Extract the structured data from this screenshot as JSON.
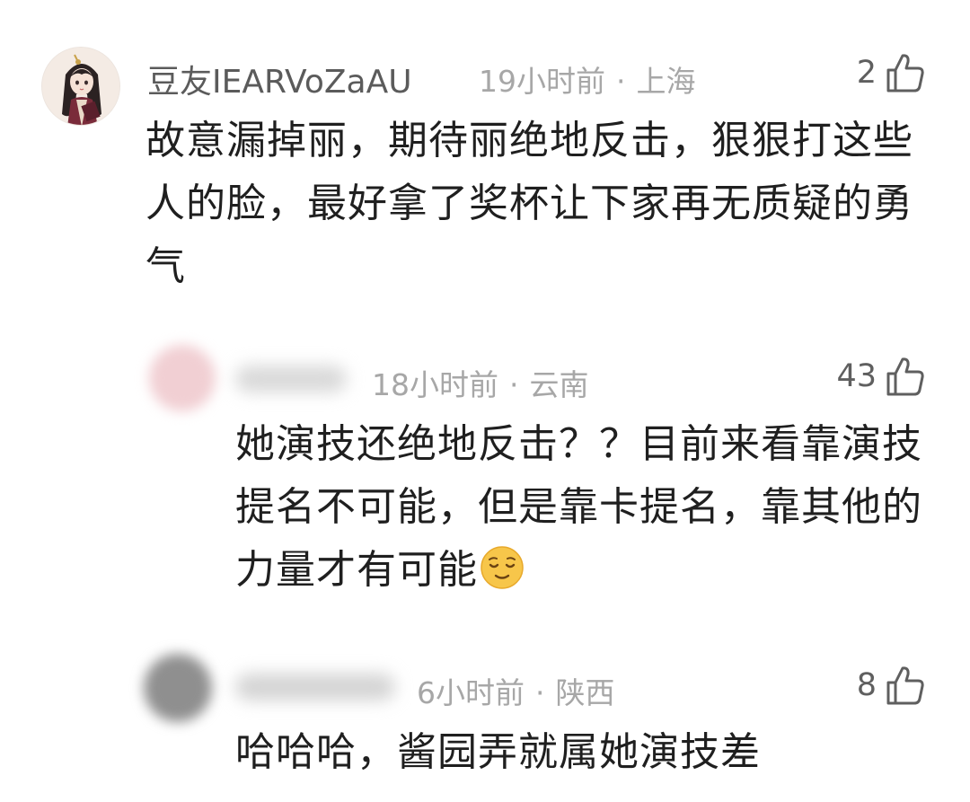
{
  "comments": [
    {
      "username": "豆友IEARVoZaAU",
      "time": "19小时前",
      "location": "上海",
      "likes": "2",
      "text": "故意漏掉丽，期待丽绝地反击，狠狠打这些人的脸，最好拿了奖杯让下家再无质疑的勇气",
      "avatar_icon": "anime-character-avatar"
    },
    {
      "username": "",
      "time": "18小时前",
      "location": "云南",
      "likes": "43",
      "text": "她演技还绝地反击？？目前来看靠演技提名不可能，但是靠卡提名，靠其他的力量才有可能",
      "emoji": "relieved-face-emoji"
    },
    {
      "username": "",
      "time": "6小时前",
      "location": "陕西",
      "likes": "8",
      "text": "哈哈哈，酱园弄就属她演技差"
    }
  ],
  "separator": "·",
  "colors": {
    "username": "#5b5b5b",
    "meta": "#a7a7a7",
    "body_text": "#1f1f1f",
    "like_count": "#5f5f5f"
  }
}
